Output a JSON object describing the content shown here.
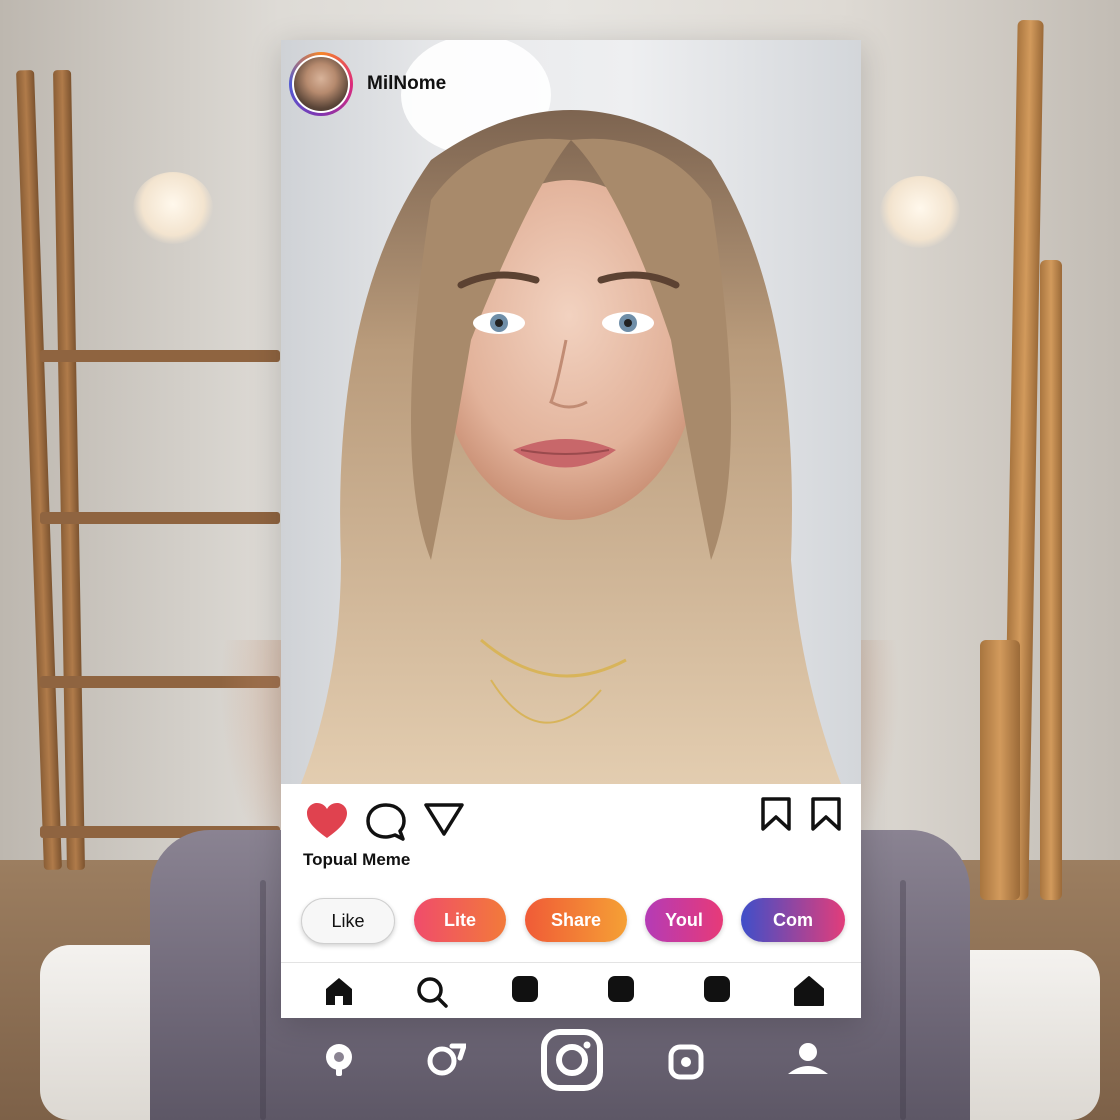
{
  "post": {
    "username": "MilNome",
    "caption": "Topual Meme"
  },
  "buttons": {
    "like": "Like",
    "lite": "Lite",
    "share": "Share",
    "youl": "Youl",
    "com": "Com"
  },
  "icons": {
    "actions": [
      "heart-icon",
      "comment-icon",
      "send-icon",
      "bookmark-icon",
      "bookmark-icon"
    ],
    "tabbar": [
      "home-icon",
      "search-icon",
      "reels-icon",
      "shop-icon",
      "activity-icon",
      "profile-icon"
    ],
    "overlay": [
      "search-icon",
      "refresh-icon",
      "instagram-logo-icon",
      "camera-icon",
      "profile-icon"
    ]
  },
  "colors": {
    "heart": "#e0424f",
    "avatar_ring": [
      "#f58529",
      "#dd2a7b",
      "#8134af",
      "#515bd4"
    ]
  }
}
